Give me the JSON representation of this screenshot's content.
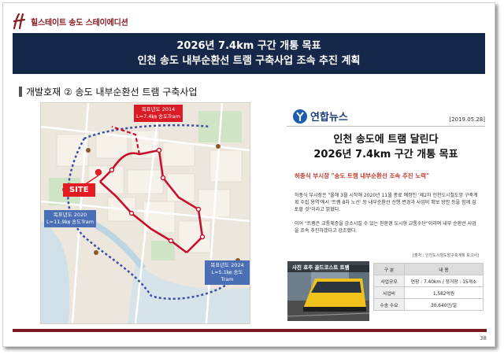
{
  "header": {
    "logo_text": "힐스테이트 송도 스테이에디션",
    "title_line1": "2026년 7.4km 구간 개통 목표",
    "title_line2": "인천 송도 내부순환선 트램 구축사업 조속 추진 계획"
  },
  "section": {
    "title": "개발호재 ② 송도 내부순환선 트램 구축사업"
  },
  "map": {
    "site_label": "SITE",
    "callout_top": [
      "목표년도 2014",
      "L=7.4㎞ 송도Tram"
    ],
    "callout_left": [
      "목표년도 2020",
      "L=11.9㎞ 송도Tram"
    ],
    "callout_bottom": [
      "목표년도 2024",
      "L=5.1㎞ 송도Tram"
    ],
    "colors": {
      "phase1": "#c8102e",
      "phase2": "#3b4fa8",
      "site": "#e31b23"
    }
  },
  "news": {
    "source_name": "연합뉴스",
    "date": "[2019.05.28]",
    "headline_line1": "인천 송도에 트램 달린다",
    "headline_line2": "2026년 7.4km 구간 개통 목표",
    "subhead": "허종식 부시장 \"송도 트램 내부순환선 조속 추진 노력\"",
    "paragraph1": "허종식 부시장은 \"올해 3월 시작해 2020년 11월 종료 예정인 '제2차 인천도시철도망 구축계획 수립 용역'에서 '트램 8차 노선' 등 내부순환선 선행 변경과 사업비 확보 방안 등을 함께 검토할 것\"이라고 밝혔다.",
    "paragraph2": "이어 \"트램은 교통체증을 감소시킬 수 있는 친환경 도시형 교통수단\"이라며 내부 순환선 사업을 조속 추진하겠다고 강조했다.",
    "source_note": "[출처 : 인천도시철도망구축계획 보고서]"
  },
  "photo": {
    "caption": "사진 호주 골드코스트 트램"
  },
  "table": {
    "headers": [
      "구 분",
      "내 용"
    ],
    "rows": [
      {
        "key": "사업규모",
        "value": "연장 : 7.40km / 정거장 : 15개소"
      },
      {
        "key": "사업비",
        "value": "1,582억원"
      },
      {
        "key": "수송 수요",
        "value": "30,640인/일"
      }
    ]
  },
  "footer": {
    "page_number": "38"
  }
}
